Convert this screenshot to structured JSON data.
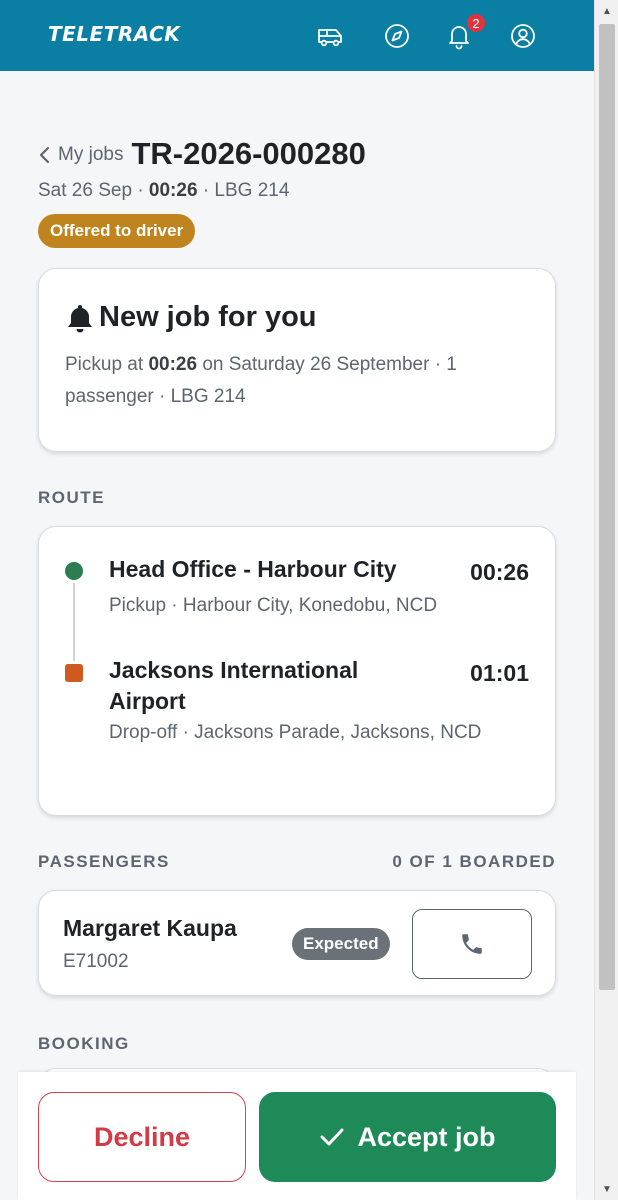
{
  "header": {
    "logo": "TELETRACK",
    "notification_count": "2"
  },
  "title": {
    "back_label": "My jobs",
    "job_id": "TR-2026-000280",
    "date": "Sat 26 Sep",
    "time": "00:26",
    "vehicle": "LBG 214",
    "separator": "·",
    "status": "Offered to driver"
  },
  "offer": {
    "heading": "New job for you",
    "text_prefix": "Pickup at",
    "time": "00:26",
    "text_suffix": "on Saturday 26 September · 1 passenger · LBG 214"
  },
  "route": {
    "label": "ROUTE",
    "stops": [
      {
        "name": "Head Office - Harbour City",
        "detail": "Pickup · Harbour City, Konedobu, NCD",
        "time": "00:26"
      },
      {
        "name": "Jacksons International Airport",
        "detail": "Drop-off · Jacksons Parade, Jacksons, NCD",
        "time": "01:01"
      }
    ]
  },
  "passengers": {
    "label": "PASSENGERS",
    "boarded": "0 OF 1 BOARDED",
    "items": [
      {
        "name": "Margaret Kaupa",
        "id": "E71002",
        "status": "Expected"
      }
    ]
  },
  "booking": {
    "label": "BOOKING"
  },
  "actions": {
    "decline": "Decline",
    "accept": "Accept job"
  },
  "colors": {
    "header": "#0a7fa3",
    "status_offered": "#c0841e",
    "pickup": "#2e7d51",
    "dropoff": "#cf5a1f",
    "accept": "#1e8a57",
    "decline": "#d23a45"
  },
  "icons": [
    "van-icon",
    "compass-icon",
    "bell-icon",
    "user-icon",
    "chevron-left-icon",
    "bell-icon",
    "phone-icon",
    "check-icon"
  ]
}
